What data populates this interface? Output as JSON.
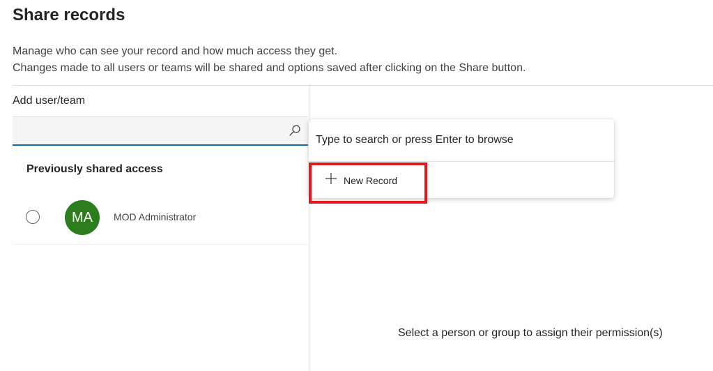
{
  "header": {
    "title": "Share records",
    "description_line1": "Manage who can see your record and how much access they get.",
    "description_line2": "Changes made to all users or teams will be shared and options saved after clicking on the Share button."
  },
  "add_user": {
    "label": "Add user/team",
    "search_value": "",
    "search_icon": "search-icon"
  },
  "previously_shared": {
    "header": "Previously shared access",
    "users": [
      {
        "initials": "MA",
        "name": "MOD Administrator",
        "avatar_color": "#2d7d1e",
        "selected": false
      }
    ]
  },
  "dropdown": {
    "hint": "Type to search or press Enter to browse",
    "new_record_label": "New Record",
    "new_record_icon": "plus-icon"
  },
  "permissions_panel": {
    "empty_message": "Select a person or group to assign their permission(s)"
  },
  "colors": {
    "accent": "#0f6cbd",
    "highlight": "#e0181f"
  }
}
